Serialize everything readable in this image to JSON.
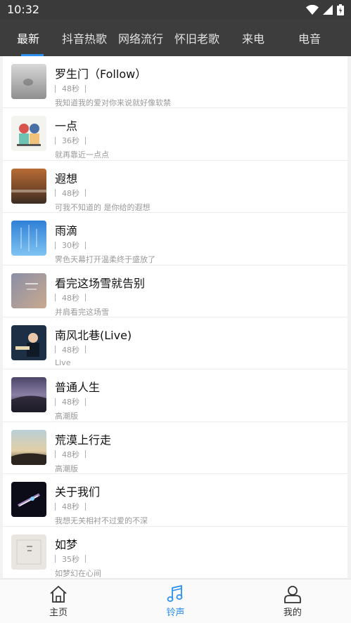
{
  "status_bar": {
    "time": "10:32",
    "icons": [
      "wifi-icon",
      "signal-icon",
      "battery-icon"
    ]
  },
  "tabs": [
    {
      "label": "最新",
      "active": true
    },
    {
      "label": "抖音热歌",
      "active": false
    },
    {
      "label": "网络流行",
      "active": false
    },
    {
      "label": "怀旧老歌",
      "active": false
    },
    {
      "label": "来电",
      "active": false
    },
    {
      "label": "电音",
      "active": false
    }
  ],
  "songs": [
    {
      "title": "罗生门（Follow）",
      "duration": "48秒",
      "desc": "我知道我的爱对你来说就好像软禁",
      "cover": "gray-mist"
    },
    {
      "title": "一点",
      "duration": "36秒",
      "desc": "就再靠近一点点",
      "cover": "cartoon-couple"
    },
    {
      "title": "遐想",
      "duration": "48秒",
      "desc": "可我不知道的 是你给的遐想",
      "cover": "autumn-field"
    },
    {
      "title": "雨滴",
      "duration": "30秒",
      "desc": "霁色天幕打开温柔终于盛放了",
      "cover": "blue-rain"
    },
    {
      "title": "看完这场雪就告别",
      "duration": "48秒",
      "desc": "并肩看完这场雪",
      "cover": "snow-dusk"
    },
    {
      "title": "南风北巷(Live)",
      "duration": "48秒",
      "desc": "Live",
      "cover": "singer-stage"
    },
    {
      "title": "普通人生",
      "duration": "48秒",
      "desc": "高潮版",
      "cover": "purple-hills"
    },
    {
      "title": "荒漠上行走",
      "duration": "48秒",
      "desc": "高潮版",
      "cover": "desert-sky"
    },
    {
      "title": "关于我们",
      "duration": "48秒",
      "desc": "我想无关相衬不过爱的不深",
      "cover": "cosmic-light"
    },
    {
      "title": "如梦",
      "duration": "35秒",
      "desc": "如梦幻在心间",
      "cover": "pale-sketch"
    }
  ],
  "bottom_nav": [
    {
      "label": "主页",
      "icon": "home-icon",
      "active": false
    },
    {
      "label": "铃声",
      "icon": "music-note-icon",
      "active": true
    },
    {
      "label": "我的",
      "icon": "user-icon",
      "active": false
    }
  ],
  "colors": {
    "accent": "#2b8ff0",
    "header_bg": "#3d3d3d",
    "status_bg": "#3a3a3a"
  }
}
